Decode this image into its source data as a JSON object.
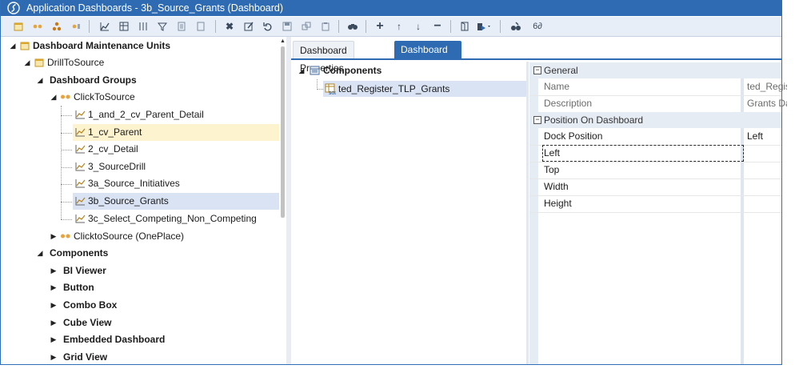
{
  "window": {
    "title": "Application Dashboards - 3b_Source_Grants (Dashboard)"
  },
  "toolbar": {
    "icons": [
      "new-icon",
      "dashboard-group-icon",
      "component-icon",
      "parameter-icon",
      "chart-icon",
      "grid-icon",
      "column-icon",
      "filter-icon",
      "page-icon",
      "copy-icon",
      "delete-icon",
      "edit-icon",
      "undo-icon",
      "save-icon",
      "save-as-icon",
      "clipboard-icon",
      "binoculars-icon",
      "add-icon",
      "move-up-icon",
      "move-down-icon",
      "remove-icon",
      "open-icon",
      "run-icon",
      "find-icon",
      "view-icon"
    ],
    "oo_label": "6∂"
  },
  "tree": {
    "root": "Dashboard Maintenance Units",
    "unit": "DrillToSource",
    "groups_header": "Dashboard Groups",
    "group1": "ClickToSource",
    "dashboards": [
      "1_and_2_cv_Parent_Detail",
      "1_cv_Parent",
      "2_cv_Detail",
      "3_SourceDrill",
      "3a_Source_Initiatives",
      "3b_Source_Grants",
      "3c_Select_Competing_Non_Competing"
    ],
    "group2": "ClicktoSource (OnePlace)",
    "components_header": "Components",
    "component_types": [
      "BI Viewer",
      "Button",
      "Combo Box",
      "Cube View",
      "Embedded Dashboard",
      "Grid View"
    ]
  },
  "tabs": {
    "properties": "Dashboard Properties",
    "components": "Dashboard Components"
  },
  "components_panel": {
    "header": "Components",
    "item": "ted_Register_TLP_Grants"
  },
  "property_grid": {
    "general": "General",
    "name_label": "Name",
    "name_value": "ted_Register_TLP_Grants",
    "description_label": "Description",
    "description_value": "Grants Data",
    "position": "Position On Dashboard",
    "dock_label": "Dock Position",
    "dock_value": "Left",
    "left_label": "Left",
    "top_label": "Top",
    "width_label": "Width",
    "height_label": "Height"
  },
  "colors": {
    "accent": "#2e6bb3",
    "selection_yellow": "#fdf3cf",
    "selection_blue": "#d9e3f3"
  }
}
